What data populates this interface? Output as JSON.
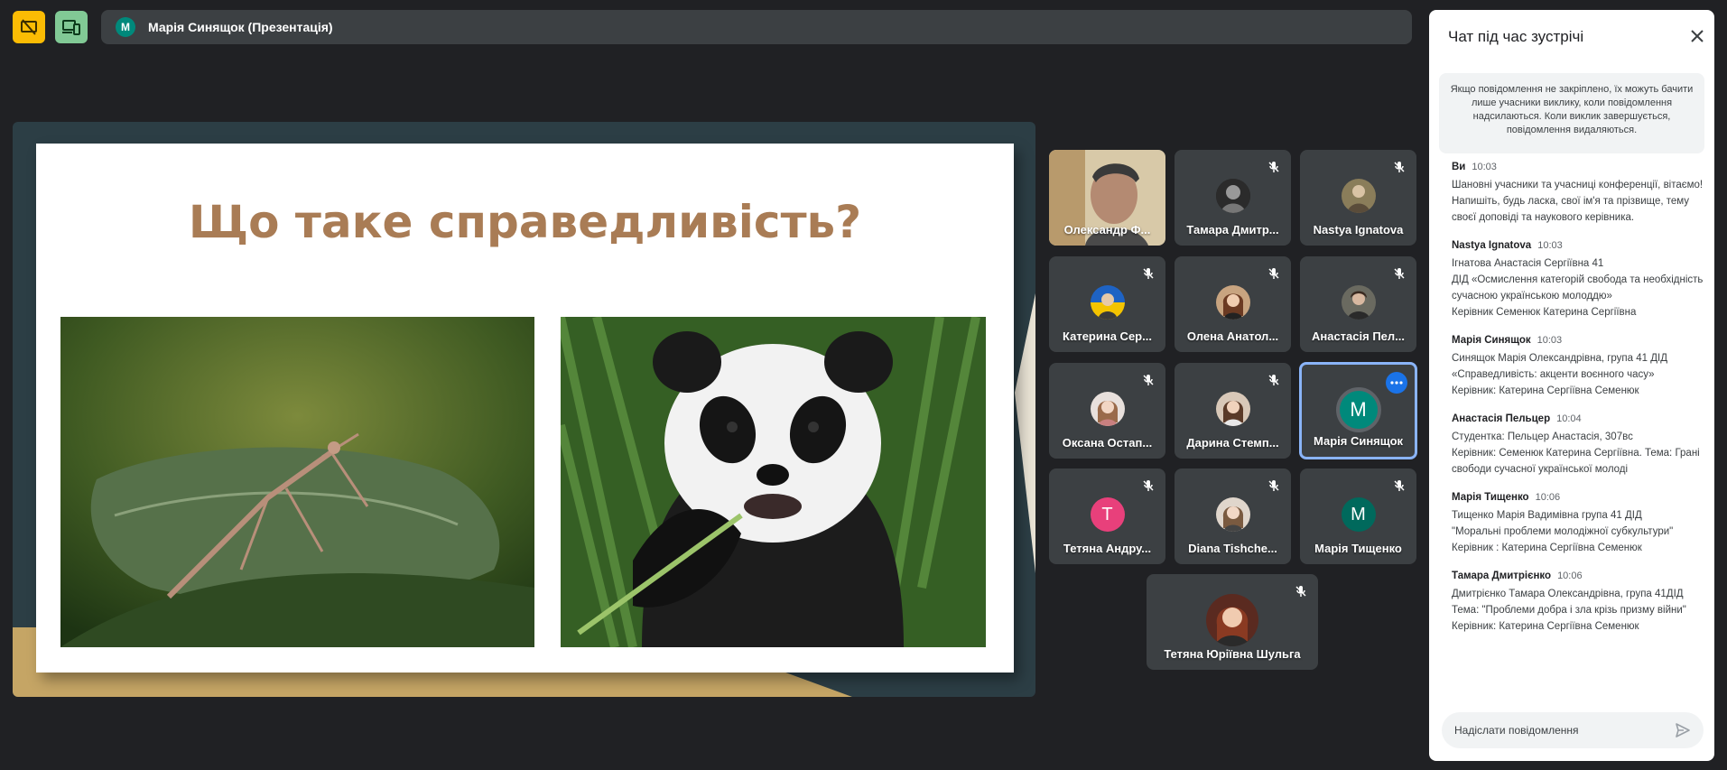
{
  "presenter": {
    "avatar_letter": "M",
    "name": "Марія Синящок (Презентація)",
    "avatar_color": "#00897b"
  },
  "slide": {
    "title": "Що таке справедливість?",
    "title_color": "#a97c55",
    "images": [
      "mantis-photo",
      "panda-photo"
    ]
  },
  "participants": [
    {
      "name": "Олександр Ф...",
      "kind": "video"
    },
    {
      "name": "Тамара Дмитр...",
      "kind": "photo",
      "muted": true
    },
    {
      "name": "Nastya Ignatova",
      "kind": "photo",
      "muted": true
    },
    {
      "name": "Катерина Сер...",
      "kind": "photo",
      "muted": true
    },
    {
      "name": "Олена Анатол...",
      "kind": "photo",
      "muted": true
    },
    {
      "name": "Анастасія Пел...",
      "kind": "photo",
      "muted": true
    },
    {
      "name": "Оксана Остап...",
      "kind": "photo",
      "muted": true
    },
    {
      "name": "Дарина Стемп...",
      "kind": "photo",
      "muted": true
    },
    {
      "name": "Марія Синящок",
      "kind": "letter",
      "letter": "M",
      "color": "#00897b",
      "active": true
    },
    {
      "name": "Тетяна Андру...",
      "kind": "letter",
      "letter": "T",
      "color": "#e8407b",
      "muted": true
    },
    {
      "name": "Diana Tishche...",
      "kind": "photo",
      "muted": true
    },
    {
      "name": "Марія Тищенко",
      "kind": "letter",
      "letter": "M",
      "color": "#00695c",
      "muted": true
    },
    {
      "name": "Тетяна Юріївна Шульга",
      "kind": "photo",
      "muted": true
    }
  ],
  "chat": {
    "title": "Чат під час зустрічі",
    "notice": "Якщо повідомлення не закріплено, їх можуть бачити лише учасники виклику, коли повідомлення надсилаються. Коли виклик завершується, повідомлення видаляються.",
    "messages": [
      {
        "sender": "Ви",
        "time": "10:03",
        "lines": [
          "Шановні учасники та учасниці конференції, вітаємо!",
          "Напишіть, будь ласка, свої ім'я та прізвище, тему своєї доповіді та наукового керівника."
        ]
      },
      {
        "sender": "Nastya Ignatova",
        "time": "10:03",
        "lines": [
          "Ігнатова Анастасія Сергіївна 41",
          "ДІД «Осмислення категорій свобода та необхідність сучасною українською молоддю»",
          "Керівник Семенюк Катерина Сергіївна"
        ]
      },
      {
        "sender": "Марія Синящок",
        "time": "10:03",
        "lines": [
          "Синящок Марія Олександрівна, група 41 ДІД «Справедливість: акценти воєнного часу»",
          "Керівник: Катерина Сергіївна Семенюк"
        ]
      },
      {
        "sender": "Анастасія Пельцер",
        "time": "10:04",
        "lines": [
          "Студентка: Пельцер Анастасія, 307вс",
          "Керівник: Семенюк Катерина Сергіївна. Тема: Грані свободи сучасної української молоді"
        ]
      },
      {
        "sender": "Марія Тищенко",
        "time": "10:06",
        "lines": [
          "Тищенко Марія Вадимівна група 41 ДІД",
          "\"Моральні проблеми молодіжної субкультури\"",
          "Керівник : Катерина Сергіївна Семенюк"
        ]
      },
      {
        "sender": "Тамара Дмитрієнко",
        "time": "10:06",
        "lines": [
          "Дмитрієнко Тамара Олександрівна, група 41ДІД",
          "Тема: \"Проблеми добра і зла крізь призму війни\"",
          "Керівник: Катерина Сергіївна Семенюк"
        ]
      }
    ],
    "input_placeholder": "Надіслати повідомлення"
  }
}
